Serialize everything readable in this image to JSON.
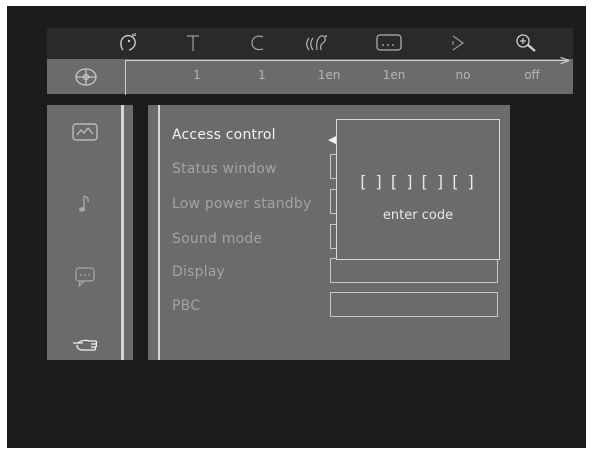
{
  "toolbar": {
    "icons": [
      "face-icon",
      "title-icon",
      "chapter-icon",
      "audio-icon",
      "subtitle-icon",
      "angle-icon",
      "zoom-icon"
    ],
    "values": [
      "1",
      "1",
      "1en",
      "1en",
      "no",
      "off"
    ]
  },
  "sidebar": {
    "icons": [
      "picture-icon",
      "music-note-icon",
      "subtitle-bubble-icon",
      "hand-pointer-icon"
    ]
  },
  "menu": {
    "items": [
      {
        "label": "Access control",
        "active": true
      },
      {
        "label": "Status window",
        "active": false
      },
      {
        "label": "Low power standby",
        "active": false
      },
      {
        "label": "Sound mode",
        "active": false
      },
      {
        "label": "Display",
        "active": false
      },
      {
        "label": "PBC",
        "active": false
      }
    ]
  },
  "popup": {
    "code": "[ ] [ ] [ ] [ ]",
    "hint": "enter code"
  }
}
